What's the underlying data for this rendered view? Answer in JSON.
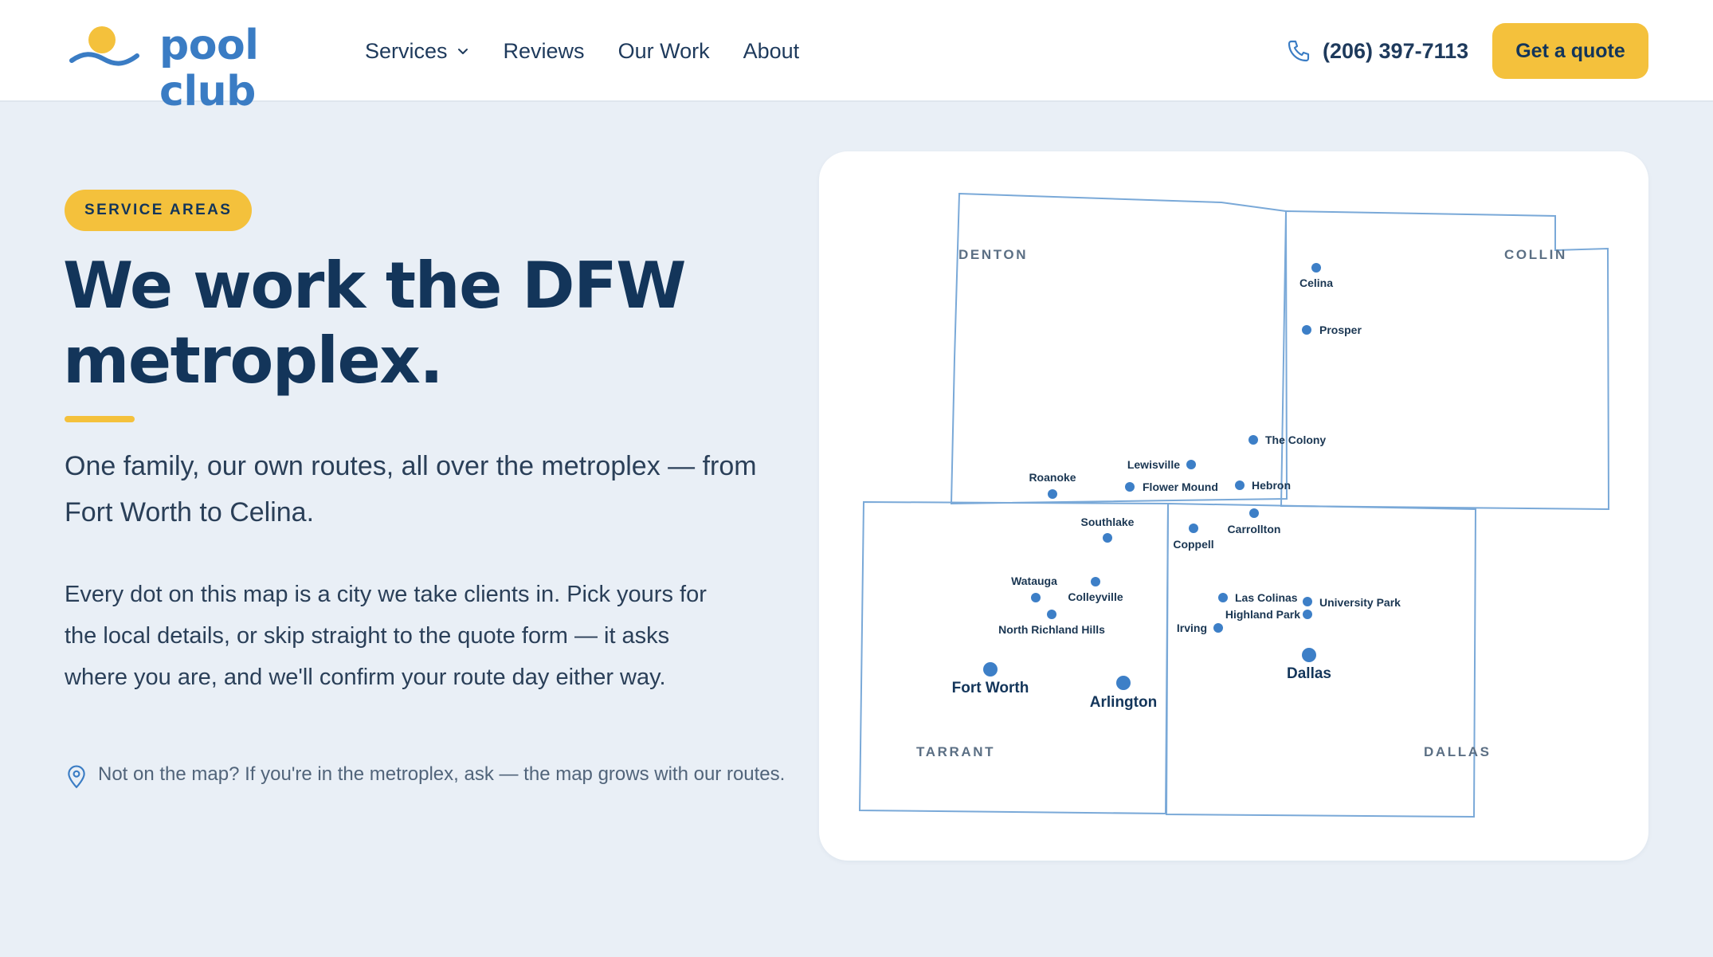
{
  "nav": {
    "logo": "pool club",
    "links": [
      "Services",
      "Reviews",
      "Our Work",
      "About"
    ],
    "phone": "(206) 397-7113",
    "cta": "Get a quote"
  },
  "hero": {
    "badge": "SERVICE AREAS",
    "headline_1": "We work the DFW",
    "headline_2": "metroplex.",
    "lead": "One family, our own routes, all over the metroplex — from Fort Worth to Celina.",
    "body": "Every dot on this map is a city we take clients in. Pick yours for the local details, or skip straight to the quote form — it asks where you are, and we'll confirm your route day either way.",
    "note": "Not on the map? If you're in the metroplex, ask — the map grows with our routes."
  },
  "map": {
    "counties": [
      "DENTON",
      "COLLIN",
      "TARRANT",
      "DALLAS"
    ],
    "cities": [
      "Celina",
      "Prosper",
      "The Colony",
      "Lewisville",
      "Roanoke",
      "Flower Mound",
      "Hebron",
      "Southlake",
      "Carrollton",
      "Coppell",
      "Watauga",
      "Colleyville",
      "North Richland Hills",
      "Las Colinas",
      "Highland Park",
      "University Park",
      "Irving",
      "Fort Worth",
      "Arlington",
      "Dallas"
    ]
  },
  "colors": {
    "accent": "#f4c13c",
    "brand_blue": "#3a7cc4",
    "navy": "#13355a",
    "background": "#e9eff6",
    "county_line": "#7aa9d8",
    "city_dot": "#3d7fc7"
  },
  "icons": [
    "sun-wave-logo-icon",
    "chevron-down-icon",
    "phone-icon",
    "map-pin-icon"
  ]
}
